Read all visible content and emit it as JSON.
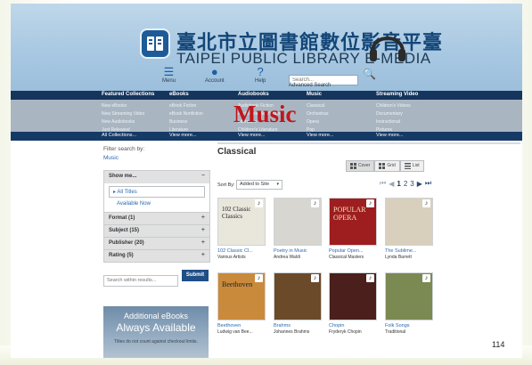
{
  "header": {
    "title_zh": "臺北市立圖書館數位影音平臺",
    "title_en": "TAIPEI PUBLIC LIBRARY E-MEDIA",
    "menu_label": "Menu",
    "account_label": "Account",
    "help_label": "Help",
    "search_placeholder": "Search...",
    "advanced_search": "Advanced Search"
  },
  "nav": {
    "columns": [
      {
        "heading": "Featured Collections",
        "items": [
          "New eBooks",
          "New Streaming Video",
          "New Audiobooks",
          "Just Released"
        ],
        "footer": "All Collections..."
      },
      {
        "heading": "eBooks",
        "items": [
          "eBook Fiction",
          "eBook Nonfiction",
          "Business",
          "Literature"
        ],
        "footer": "View more..."
      },
      {
        "heading": "Audiobooks",
        "items": [
          "Audiobook Fiction",
          "Audiobook Nonfiction",
          "Literature",
          "Children's Literature"
        ],
        "footer": "View more..."
      },
      {
        "heading": "Music",
        "items": [
          "Classical",
          "Orchestras",
          "Opera",
          "Pop"
        ],
        "footer": "View more..."
      },
      {
        "heading": "Streaming Video",
        "items": [
          "Children's Videos",
          "Documentary",
          "Instructional",
          "Pictures"
        ],
        "footer": "View more..."
      }
    ],
    "overlay_label": "Music"
  },
  "sidebar": {
    "filter_label": "Filter search by:",
    "filter_value": "Music",
    "show_me": "Show me...",
    "all_titles": "All Titles",
    "available_now": "Available Now",
    "facets": [
      "Format (1)",
      "Subject (15)",
      "Publisher (20)",
      "Rating (5)"
    ],
    "within_placeholder": "Search within results...",
    "submit_label": "Submit",
    "promo": {
      "line1": "Additional eBooks",
      "line2": "Always Available",
      "line3": "Titles do not count against checkout limits."
    }
  },
  "main": {
    "title": "Classical",
    "view_options": [
      "Cover",
      "Grid",
      "List"
    ],
    "sort_label": "Sort By:",
    "sort_value": "Added to Site",
    "pager": {
      "first": "⏮",
      "prev": "◀",
      "current": "1",
      "pages": [
        "2",
        "3"
      ],
      "next": "▶",
      "last": "⏭"
    },
    "items": [
      {
        "title": "102 Classic Cl...",
        "artist": "Various Artists",
        "cover_text": "102 Classic Classics",
        "bg": "#e9e6dc"
      },
      {
        "title": "Poetry in Music",
        "artist": "Andrea Waldi",
        "cover_text": "",
        "bg": "#d8d6d0"
      },
      {
        "title": "Popular Open...",
        "artist": "Classical Masters",
        "cover_text": "POPULAR OPERA",
        "bg": "#9e1d1e"
      },
      {
        "title": "The Sublime...",
        "artist": "Lynda Barrett",
        "cover_text": "",
        "bg": "#d9cfbd"
      },
      {
        "title": "Beethoven",
        "artist": "Ludwig van Bee...",
        "cover_text": "Beethoven",
        "bg": "#c98a3c"
      },
      {
        "title": "Brahms",
        "artist": "Johannes Brahms",
        "cover_text": "",
        "bg": "#6b4a2a"
      },
      {
        "title": "Chopin",
        "artist": "Fryderyk Chopin",
        "cover_text": "",
        "bg": "#4a1f1c"
      },
      {
        "title": "Folk Songs",
        "artist": "Traditional",
        "cover_text": "",
        "bg": "#7a8a52"
      }
    ]
  },
  "slide": {
    "page_number": "114"
  }
}
